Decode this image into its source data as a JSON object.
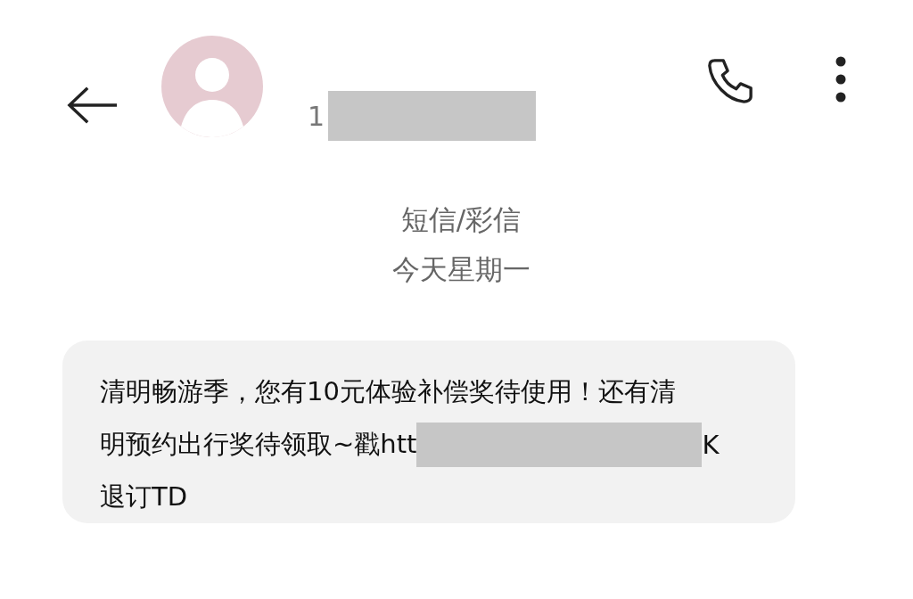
{
  "header": {
    "number_start": "1",
    "number_redacted": true
  },
  "info": {
    "channel": "短信/彩信",
    "date": "今天星期一"
  },
  "message": {
    "lines": [
      {
        "text": "清明畅游季，您有10元体验补偿奖待使用！还有清",
        "redacted_after": false
      },
      {
        "text": "明预约出行奖待领取~戳htt",
        "redacted_after": true,
        "tail": "K"
      },
      {
        "text": "退订TD",
        "redacted_after": false
      }
    ]
  }
}
